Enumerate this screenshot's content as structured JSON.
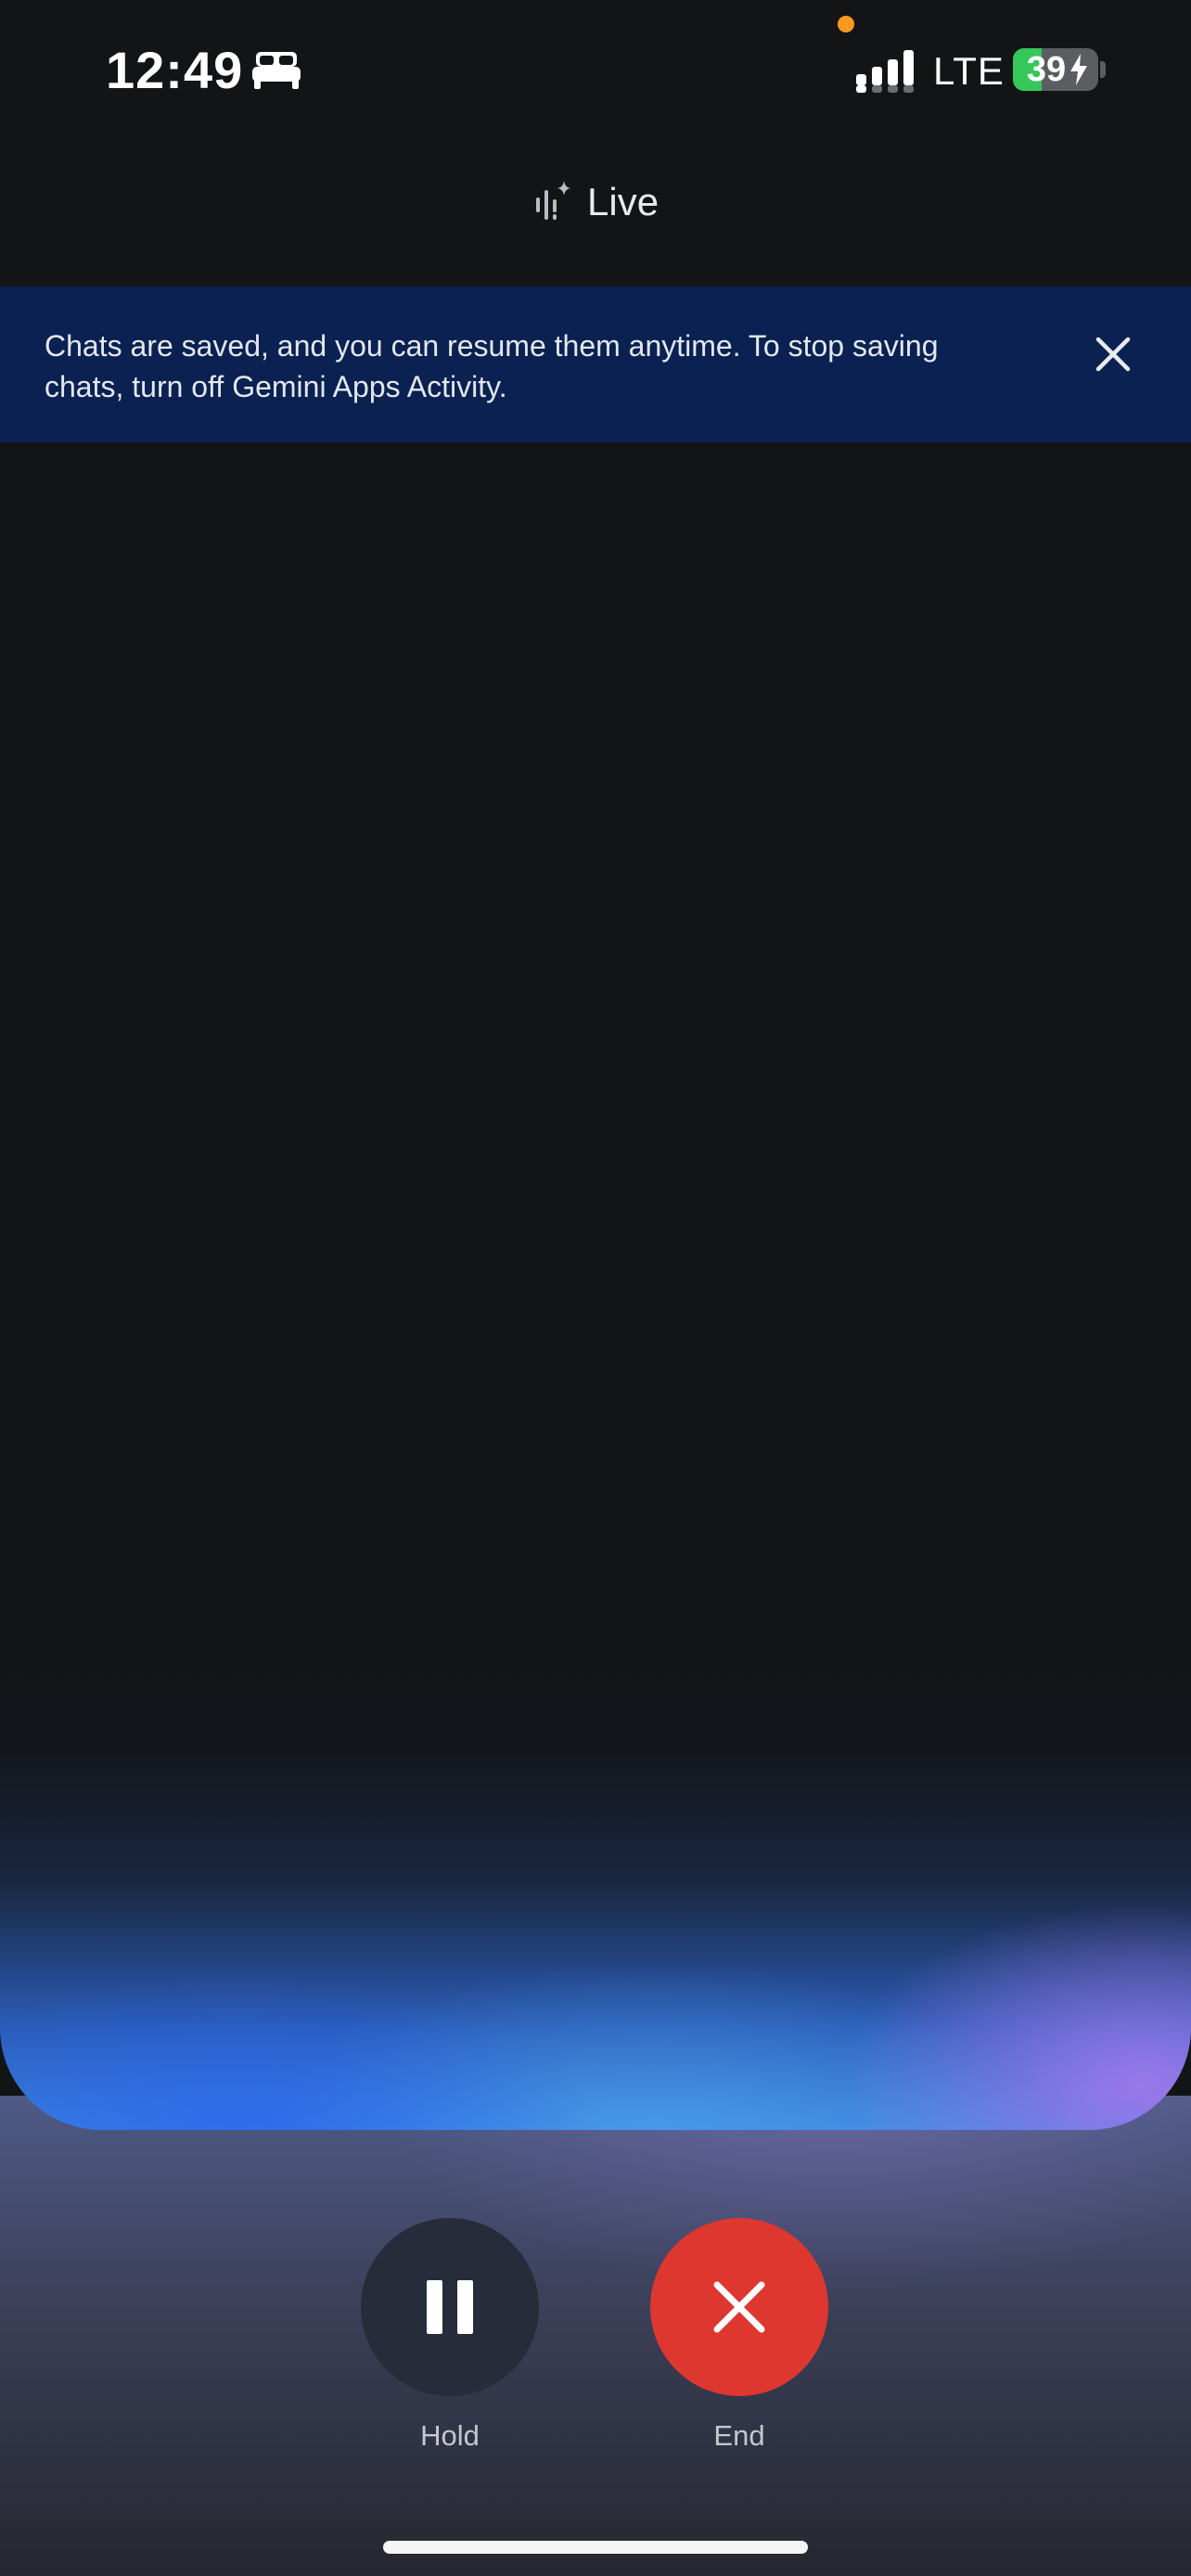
{
  "status_bar": {
    "time": "12:49",
    "sleep_icon": "bed-icon",
    "network": "LTE",
    "battery_percent": "39",
    "battery_level": 0.39,
    "battery_charging": true,
    "privacy_dot_color": "#f89a22"
  },
  "header": {
    "icon": "live-waveform-sparkle-icon",
    "title": "Live"
  },
  "banner": {
    "message": "Chats are saved, and you can resume them anytime. To stop saving chats, turn off Gemini Apps Activity.",
    "close_icon": "close-icon"
  },
  "controls": {
    "hold": {
      "label": "Hold",
      "icon": "pause-icon",
      "color": "#262c39"
    },
    "end": {
      "label": "End",
      "icon": "close-icon",
      "color": "#de3730"
    }
  },
  "colors": {
    "background": "#131416",
    "banner_background": "#0a2151",
    "glow_blue": "#3c84e0",
    "glow_purple": "#a078eb"
  }
}
